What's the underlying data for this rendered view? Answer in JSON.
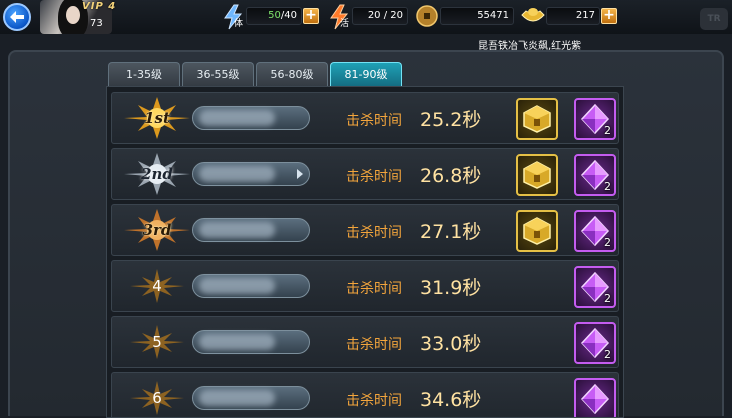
{
  "header": {
    "vip_label": "VIP 4",
    "level": "73",
    "stamina": {
      "label": "体",
      "value": "50",
      "max": "/40"
    },
    "vitality": {
      "label": "活",
      "value": "20 / 20"
    },
    "coins": "55471",
    "gold": "217",
    "notice": "昆吾铁冶飞炎飙,红光紫",
    "corner_logo": "TR"
  },
  "tabs": [
    {
      "label": "1-35级",
      "active": false
    },
    {
      "label": "36-55级",
      "active": false
    },
    {
      "label": "56-80级",
      "active": false
    },
    {
      "label": "81-90级",
      "active": true
    }
  ],
  "rows": [
    {
      "rank": "1st",
      "name": "",
      "kill_label": "击杀时间",
      "kill_time": "25.2秒",
      "gold_reward": true,
      "purple_qty": "2"
    },
    {
      "rank": "2nd",
      "name": "",
      "kill_label": "击杀时间",
      "kill_time": "26.8秒",
      "gold_reward": true,
      "purple_qty": "2"
    },
    {
      "rank": "3rd",
      "name": "",
      "kill_label": "击杀时间",
      "kill_time": "27.1秒",
      "gold_reward": true,
      "purple_qty": "2"
    },
    {
      "rank": "4",
      "name": "",
      "kill_label": "击杀时间",
      "kill_time": "31.9秒",
      "gold_reward": false,
      "purple_qty": "2"
    },
    {
      "rank": "5",
      "name": "",
      "kill_label": "击杀时间",
      "kill_time": "33.0秒",
      "gold_reward": false,
      "purple_qty": "2"
    },
    {
      "rank": "6",
      "name": "",
      "kill_label": "击杀时间",
      "kill_time": "34.6秒",
      "gold_reward": false,
      "purple_qty": ""
    }
  ],
  "colors": {
    "accent_tab": "#1fa1b6",
    "kill_label": "#f3a53c",
    "kill_time": "#ffe2a2"
  }
}
